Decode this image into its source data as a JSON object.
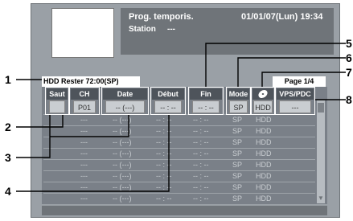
{
  "header": {
    "title": "Prog. temporis.",
    "datetime": "01/01/07(Lun) 19:34",
    "station_label": "Station",
    "station_value": "---",
    "hdd_remaining": "HDD Rester   72:00(SP)",
    "page": "Page 1/4"
  },
  "columns": {
    "saut": "Saut",
    "ch": "CH",
    "date": "Date",
    "debut": "Début",
    "fin": "Fin",
    "mode": "Mode",
    "vps": "VPS/PDC"
  },
  "active_row": {
    "ch": "P01",
    "date": "-- (---)",
    "debut": "-- : --",
    "fin": "-- : --",
    "mode": "SP",
    "dest": "HDD",
    "vps": "---"
  },
  "rows": [
    {
      "ch": "---",
      "date": "-- (---)",
      "debut": "-- : --",
      "fin": "-- : --",
      "mode": "SP",
      "dest": "HDD"
    },
    {
      "ch": "---",
      "date": "-- (---)",
      "debut": "-- : --",
      "fin": "-- : --",
      "mode": "SP",
      "dest": "HDD"
    },
    {
      "ch": "---",
      "date": "-- (---)",
      "debut": "-- : --",
      "fin": "-- : --",
      "mode": "SP",
      "dest": "HDD"
    },
    {
      "ch": "---",
      "date": "-- (---)",
      "debut": "-- : --",
      "fin": "-- : --",
      "mode": "SP",
      "dest": "HDD"
    },
    {
      "ch": "---",
      "date": "-- (---)",
      "debut": "-- : --",
      "fin": "-- : --",
      "mode": "SP",
      "dest": "HDD"
    },
    {
      "ch": "---",
      "date": "-- (---)",
      "debut": "-- : --",
      "fin": "-- : --",
      "mode": "SP",
      "dest": "HDD"
    },
    {
      "ch": "---",
      "date": "-- (---)",
      "debut": "-- : --",
      "fin": "-- : --",
      "mode": "SP",
      "dest": "HDD"
    },
    {
      "ch": "---",
      "date": "-- (---)",
      "debut": "-- : --",
      "fin": "-- : --",
      "mode": "SP",
      "dest": "HDD"
    },
    {
      "ch": "---",
      "date": "-- (---)",
      "debut": "-- : --",
      "fin": "-- : --",
      "mode": "SP",
      "dest": "HDD"
    }
  ],
  "callouts": [
    "1",
    "2",
    "3",
    "4",
    "5",
    "6",
    "7",
    "8"
  ],
  "icons": {
    "disc": "disc-icon"
  }
}
